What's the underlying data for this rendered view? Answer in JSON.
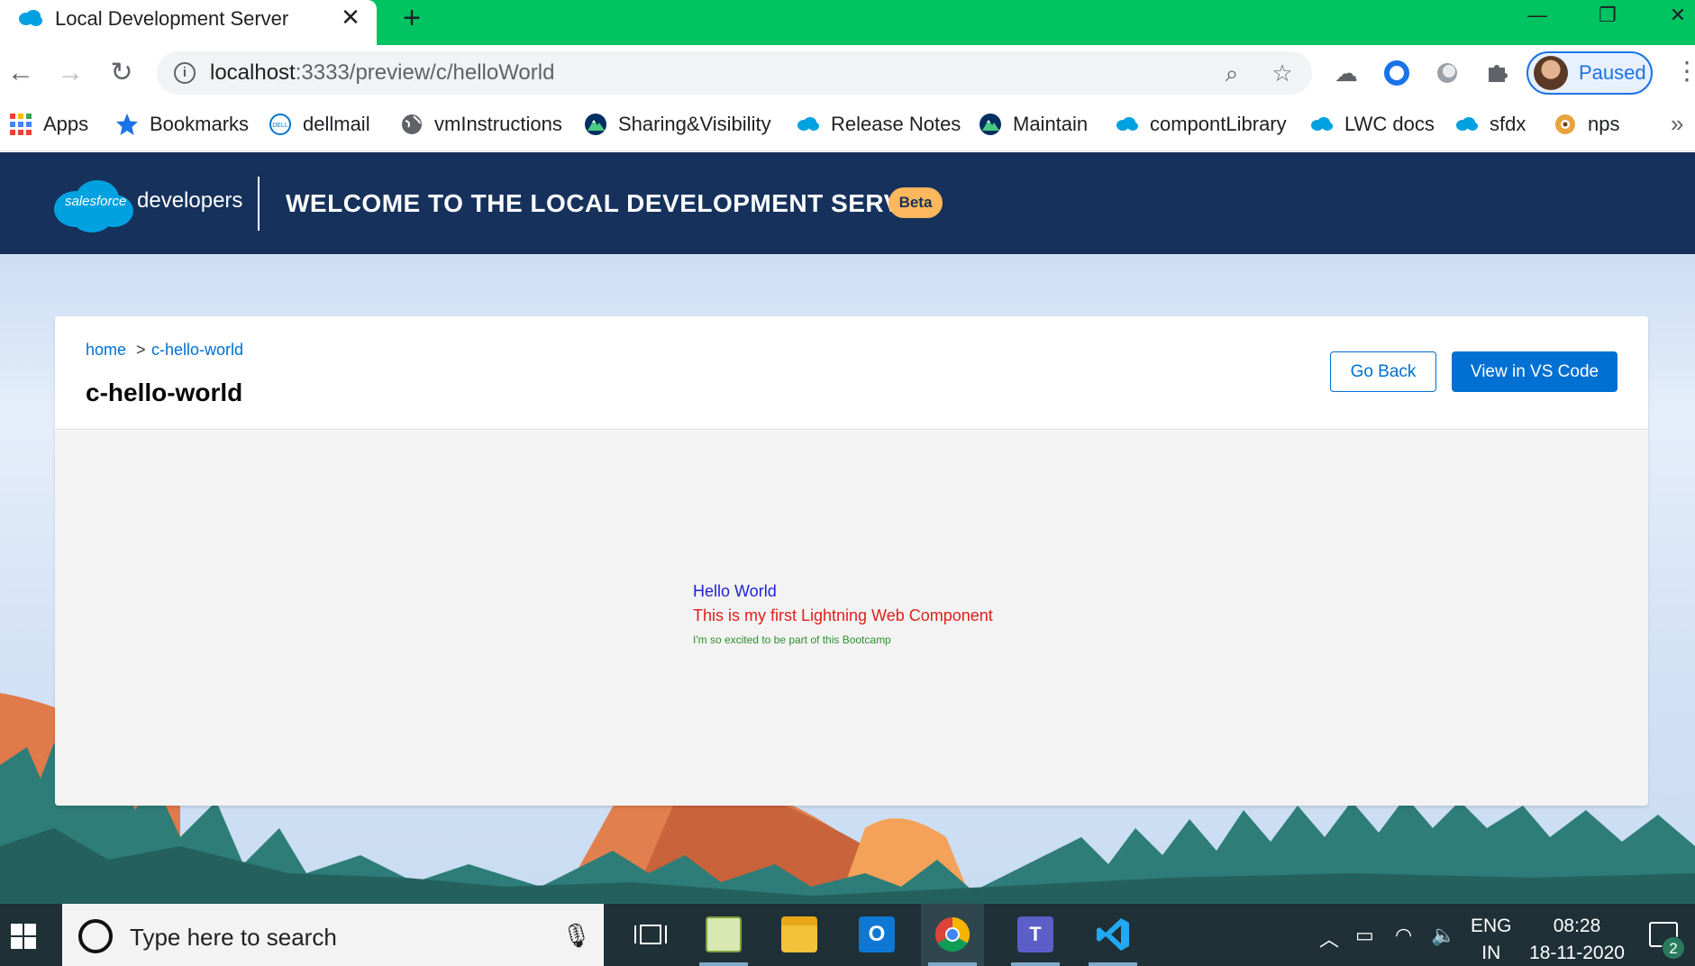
{
  "browser": {
    "tab_title": "Local Development Server",
    "tab_close": "✕",
    "new_tab": "+",
    "url_host": "localhost",
    "url_rest": ":3333/preview/c/helloWorld",
    "profile_label": "Paused"
  },
  "bookmarks": [
    {
      "label": "Apps",
      "icon": "apps-grid-icon"
    },
    {
      "label": "Bookmarks",
      "icon": "star-icon"
    },
    {
      "label": "dellmail",
      "icon": "dell-icon"
    },
    {
      "label": "vmInstructions",
      "icon": "globe-icon"
    },
    {
      "label": "Sharing&Visibility",
      "icon": "trailhead-icon"
    },
    {
      "label": "Release Notes",
      "icon": "salesforce-cloud-icon"
    },
    {
      "label": "Maintain",
      "icon": "trailhead-icon"
    },
    {
      "label": "compontLibrary",
      "icon": "salesforce-cloud-icon"
    },
    {
      "label": "LWC docs",
      "icon": "salesforce-cloud-icon"
    },
    {
      "label": "sfdx",
      "icon": "salesforce-cloud-icon"
    },
    {
      "label": "nps",
      "icon": "nps-icon"
    }
  ],
  "bookmarks_overflow": "»",
  "header": {
    "logo_text": "salesforce",
    "brand": "developers",
    "title": "WELCOME TO THE LOCAL DEVELOPMENT SERVER",
    "badge": "Beta"
  },
  "card": {
    "breadcrumb_home": "home",
    "breadcrumb_sep": ">",
    "breadcrumb_current": "c-hello-world",
    "title": "c-hello-world",
    "go_back": "Go Back",
    "view_vscode": "View in VS Code"
  },
  "component": {
    "hello": "Hello World",
    "first_lwc": "This is my first Lightning Web Component",
    "excited": "I'm so excited to be part of this Bootcamp"
  },
  "taskbar": {
    "search_placeholder": "Type here to search",
    "lang_line1": "ENG",
    "lang_line2": "IN",
    "time": "08:28",
    "date": "18-11-2020",
    "notification_count": "2"
  },
  "colors": {
    "tab_strip": "#00c462",
    "sf_header": "#16325c",
    "brand_blue": "#0070d2",
    "beta_badge": "#ffb75d"
  }
}
